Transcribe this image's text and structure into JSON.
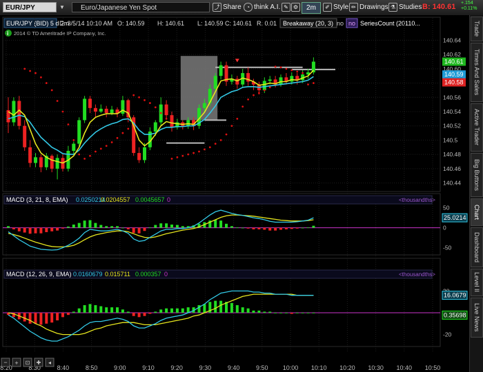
{
  "toolbar": {
    "symbol": "EUR/JPY",
    "description": "Euro/Japanese Yen Spot",
    "share": "Share",
    "think": "think A.I.",
    "aggregation": "2m",
    "style": "Style",
    "drawings": "Drawings",
    "studies": "Studies",
    "bid_price": "B: 140.61",
    "change": "+.154",
    "change_pct": "+0.11%"
  },
  "sidebar": {
    "tabs": [
      "Trade",
      "Times And Sales",
      "Active Trader",
      "Big Buttons",
      "Chart",
      "Dashboard",
      "Level II",
      "Live News"
    ]
  },
  "price_header": {
    "symbol": "EUR/JPY (BID) 5 d 2m",
    "date": "D: 3/5/14 10:10 AM",
    "open": "O: 140.59",
    "high": "H: 140.61",
    "low": "L: 140.59",
    "close": "C: 140.61",
    "range": "R: 0.01",
    "study": "Breakaway (20, 3)",
    "no1": "no",
    "no2": "no",
    "series": "SeriesCount (20110...",
    "copyright": "2014 © TD Ameritrade IP Company, Inc."
  },
  "colors": {
    "up": "#22dd22",
    "down": "#ee2222",
    "fast_ma": "#e6e61e",
    "slow_ma": "#33c9e6",
    "psar": "#dd1111",
    "zero_line": "#cc33cc"
  },
  "chart_data": [
    {
      "type": "candlestick",
      "title": "EUR/JPY (BID) 5 d 2m",
      "y_ticks": [
        "140.64",
        "140.62",
        "140.60",
        "140.58",
        "140.56",
        "140.54",
        "140.52",
        "140.5",
        "140.48",
        "140.46",
        "140.44"
      ],
      "y_tick_values": [
        140.64,
        140.62,
        140.6,
        140.58,
        140.56,
        140.54,
        140.52,
        140.5,
        140.48,
        140.46,
        140.44
      ],
      "ylim": [
        140.428,
        140.652
      ],
      "x_labels": [
        "8:20",
        "8:30",
        "8:40",
        "8:50",
        "9:00",
        "9:10",
        "9:20",
        "9:30",
        "9:40",
        "9:50",
        "10:00",
        "10:10",
        "10:20",
        "10:30",
        "10:40",
        "10:50"
      ],
      "price_labels": [
        {
          "text": "140.61",
          "value": 140.61,
          "color": "#1fb81f"
        },
        {
          "text": "140.59",
          "value": 140.592,
          "color": "#1e9bd6"
        },
        {
          "text": "140.58",
          "value": 140.581,
          "color": "#dd2222"
        }
      ],
      "candles": [
        {
          "o": 140.542,
          "c": 140.525,
          "h": 140.56,
          "l": 140.51
        },
        {
          "o": 140.525,
          "c": 140.555,
          "h": 140.56,
          "l": 140.52
        },
        {
          "o": 140.555,
          "c": 140.52,
          "h": 140.562,
          "l": 140.515
        },
        {
          "o": 140.52,
          "c": 140.49,
          "h": 140.528,
          "l": 140.485
        },
        {
          "o": 140.49,
          "c": 140.468,
          "h": 140.5,
          "l": 140.462
        },
        {
          "o": 140.468,
          "c": 140.476,
          "h": 140.482,
          "l": 140.462
        },
        {
          "o": 140.476,
          "c": 140.462,
          "h": 140.48,
          "l": 140.455
        },
        {
          "o": 140.462,
          "c": 140.478,
          "h": 140.482,
          "l": 140.458
        },
        {
          "o": 140.478,
          "c": 140.46,
          "h": 140.48,
          "l": 140.455
        },
        {
          "o": 140.46,
          "c": 140.475,
          "h": 140.48,
          "l": 140.445
        },
        {
          "o": 140.475,
          "c": 140.46,
          "h": 140.48,
          "l": 140.456
        },
        {
          "o": 140.46,
          "c": 140.485,
          "h": 140.492,
          "l": 140.456
        },
        {
          "o": 140.485,
          "c": 140.495,
          "h": 140.498,
          "l": 140.48
        },
        {
          "o": 140.495,
          "c": 140.528,
          "h": 140.532,
          "l": 140.49
        },
        {
          "o": 140.528,
          "c": 140.558,
          "h": 140.562,
          "l": 140.524
        },
        {
          "o": 140.558,
          "c": 140.545,
          "h": 140.562,
          "l": 140.538
        },
        {
          "o": 140.545,
          "c": 140.54,
          "h": 140.55,
          "l": 140.532
        },
        {
          "o": 140.54,
          "c": 140.544,
          "h": 140.55,
          "l": 140.538
        },
        {
          "o": 140.544,
          "c": 140.538,
          "h": 140.548,
          "l": 140.532
        },
        {
          "o": 140.538,
          "c": 140.543,
          "h": 140.548,
          "l": 140.535
        },
        {
          "o": 140.543,
          "c": 140.537,
          "h": 140.546,
          "l": 140.532
        },
        {
          "o": 140.537,
          "c": 140.556,
          "h": 140.562,
          "l": 140.534
        },
        {
          "o": 140.556,
          "c": 140.532,
          "h": 140.558,
          "l": 140.525
        },
        {
          "o": 140.532,
          "c": 140.482,
          "h": 140.535,
          "l": 140.478
        },
        {
          "o": 140.482,
          "c": 140.472,
          "h": 140.49,
          "l": 140.468
        },
        {
          "o": 140.472,
          "c": 140.49,
          "h": 140.496,
          "l": 140.468
        },
        {
          "o": 140.49,
          "c": 140.512,
          "h": 140.518,
          "l": 140.486
        },
        {
          "o": 140.512,
          "c": 140.525,
          "h": 140.528,
          "l": 140.506
        },
        {
          "o": 140.525,
          "c": 140.55,
          "h": 140.56,
          "l": 140.52
        },
        {
          "o": 140.55,
          "c": 140.535,
          "h": 140.556,
          "l": 140.53
        },
        {
          "o": 140.535,
          "c": 140.518,
          "h": 140.54,
          "l": 140.512
        },
        {
          "o": 140.518,
          "c": 140.525,
          "h": 140.53,
          "l": 140.515
        },
        {
          "o": 140.525,
          "c": 140.52,
          "h": 140.528,
          "l": 140.515
        },
        {
          "o": 140.52,
          "c": 140.528,
          "h": 140.532,
          "l": 140.516
        },
        {
          "o": 140.528,
          "c": 140.52,
          "h": 140.532,
          "l": 140.514
        },
        {
          "o": 140.52,
          "c": 140.545,
          "h": 140.55,
          "l": 140.516
        },
        {
          "o": 140.545,
          "c": 140.552,
          "h": 140.558,
          "l": 140.54
        },
        {
          "o": 140.552,
          "c": 140.572,
          "h": 140.578,
          "l": 140.548
        },
        {
          "o": 140.572,
          "c": 140.59,
          "h": 140.594,
          "l": 140.568
        },
        {
          "o": 140.59,
          "c": 140.605,
          "h": 140.61,
          "l": 140.585
        },
        {
          "o": 140.605,
          "c": 140.582,
          "h": 140.61,
          "l": 140.576
        },
        {
          "o": 140.582,
          "c": 140.586,
          "h": 140.592,
          "l": 140.578
        },
        {
          "o": 140.586,
          "c": 140.578,
          "h": 140.59,
          "l": 140.572
        },
        {
          "o": 140.578,
          "c": 140.594,
          "h": 140.6,
          "l": 140.575
        },
        {
          "o": 140.594,
          "c": 140.582,
          "h": 140.602,
          "l": 140.576
        },
        {
          "o": 140.582,
          "c": 140.578,
          "h": 140.586,
          "l": 140.57
        },
        {
          "o": 140.578,
          "c": 140.57,
          "h": 140.582,
          "l": 140.564
        },
        {
          "o": 140.57,
          "c": 140.583,
          "h": 140.588,
          "l": 140.566
        },
        {
          "o": 140.583,
          "c": 140.585,
          "h": 140.59,
          "l": 140.578
        },
        {
          "o": 140.585,
          "c": 140.578,
          "h": 140.59,
          "l": 140.574
        },
        {
          "o": 140.578,
          "c": 140.588,
          "h": 140.592,
          "l": 140.575
        },
        {
          "o": 140.588,
          "c": 140.582,
          "h": 140.594,
          "l": 140.578
        },
        {
          "o": 140.582,
          "c": 140.59,
          "h": 140.595,
          "l": 140.578
        },
        {
          "o": 140.59,
          "c": 140.584,
          "h": 140.594,
          "l": 140.578
        },
        {
          "o": 140.584,
          "c": 140.592,
          "h": 140.598,
          "l": 140.58
        },
        {
          "o": 140.592,
          "c": 140.595,
          "h": 140.6,
          "l": 140.586
        },
        {
          "o": 140.595,
          "c": 140.61,
          "h": 140.616,
          "l": 140.592
        }
      ],
      "fast_ma": [
        140.54,
        140.535,
        140.542,
        140.535,
        140.515,
        140.495,
        140.482,
        140.476,
        140.472,
        140.47,
        140.468,
        140.472,
        140.478,
        140.49,
        140.51,
        140.525,
        140.532,
        140.535,
        140.537,
        140.537,
        140.537,
        140.542,
        140.538,
        140.52,
        140.5,
        140.492,
        140.498,
        140.508,
        140.52,
        140.526,
        140.524,
        140.523,
        140.522,
        140.523,
        140.522,
        140.53,
        140.539,
        140.553,
        140.568,
        140.583,
        140.585,
        140.586,
        140.583,
        140.587,
        140.585,
        140.582,
        140.577,
        140.578,
        140.58,
        140.579,
        140.582,
        140.582,
        140.585,
        140.584,
        140.587,
        140.59,
        140.598
      ],
      "slow_ma": [
        140.53,
        140.532,
        140.535,
        140.533,
        140.525,
        140.514,
        140.504,
        140.497,
        140.49,
        140.486,
        140.481,
        140.48,
        140.48,
        140.486,
        140.496,
        140.504,
        140.511,
        140.516,
        140.52,
        140.523,
        140.525,
        140.529,
        140.53,
        140.524,
        140.514,
        140.508,
        140.508,
        140.51,
        140.515,
        140.518,
        140.518,
        140.519,
        140.519,
        140.52,
        140.52,
        140.524,
        140.529,
        140.538,
        140.548,
        140.56,
        140.564,
        140.568,
        140.57,
        140.574,
        140.575,
        140.575,
        140.574,
        140.575,
        140.576,
        140.577,
        140.578,
        140.579,
        140.58,
        140.581,
        140.582,
        140.584,
        140.589
      ],
      "psar": [
        [
          3,
          140.6
        ],
        [
          4,
          140.597
        ],
        [
          5,
          140.594
        ],
        [
          6,
          140.588
        ],
        [
          7,
          140.58
        ],
        [
          8,
          140.57
        ],
        [
          9,
          140.555
        ],
        [
          10,
          140.54
        ],
        [
          11,
          140.522
        ],
        [
          12,
          140.5
        ],
        [
          13,
          140.48
        ],
        [
          14,
          140.474
        ],
        [
          15,
          140.478
        ],
        [
          16,
          140.484
        ],
        [
          17,
          140.488
        ],
        [
          18,
          140.492
        ],
        [
          19,
          140.497
        ],
        [
          20,
          140.503
        ],
        [
          21,
          140.51
        ],
        [
          22,
          140.516
        ],
        [
          23,
          140.563
        ],
        [
          24,
          140.56
        ],
        [
          25,
          140.556
        ],
        [
          26,
          140.552
        ],
        [
          27,
          140.546
        ],
        [
          28,
          140.538
        ],
        [
          29,
          140.53
        ],
        [
          30,
          140.474
        ],
        [
          31,
          140.476
        ],
        [
          32,
          140.478
        ],
        [
          33,
          140.48
        ],
        [
          34,
          140.482
        ],
        [
          35,
          140.484
        ],
        [
          36,
          140.487
        ],
        [
          37,
          140.49
        ],
        [
          38,
          140.495
        ],
        [
          39,
          140.5
        ],
        [
          40,
          140.508
        ],
        [
          41,
          140.52
        ],
        [
          42,
          140.53
        ],
        [
          43,
          140.547
        ],
        [
          44,
          140.557
        ],
        [
          45,
          140.563
        ],
        [
          46,
          140.566
        ],
        [
          47,
          140.57
        ],
        [
          48,
          140.574
        ],
        [
          49,
          140.603
        ],
        [
          50,
          140.602
        ],
        [
          51,
          140.6
        ],
        [
          52,
          140.598
        ],
        [
          53,
          140.596
        ],
        [
          54,
          140.594
        ],
        [
          55,
          140.578
        ],
        [
          56,
          140.58
        ]
      ],
      "breakaway_box": {
        "i0": 32,
        "i1": 38,
        "low": 140.528,
        "high": 140.618
      },
      "lines": [
        {
          "i0": 29,
          "i1": 36,
          "v": 140.496
        },
        {
          "i0": 36,
          "i1": 40,
          "v": 140.528
        },
        {
          "i0": 38,
          "i1": 54,
          "v": 140.602
        },
        {
          "i0": 52,
          "i1": 60,
          "v": 140.599
        }
      ],
      "arrow_index": 42
    },
    {
      "type": "bar",
      "title": "MACD (3, 21, 8, EMA)",
      "values_text": [
        "0.0250214",
        "0.0204557",
        "0.0045657",
        "0"
      ],
      "units_label": "<thousandths>",
      "y_ticks": [
        "50",
        "0",
        "-50"
      ],
      "y_tick_values": [
        50,
        0,
        -50
      ],
      "ylim": [
        -68,
        58
      ],
      "value_label": "25.0214",
      "value_label_value": 25.02,
      "macd": [
        -10,
        -20,
        -30,
        -38,
        -46,
        -50,
        -54,
        -55,
        -56,
        -55,
        -50,
        -44,
        -36,
        -26,
        -12,
        -4,
        -6,
        -8,
        -8,
        -6,
        -4,
        -8,
        -14,
        -28,
        -34,
        -32,
        -24,
        -16,
        -8,
        -4,
        -4,
        -2,
        -2,
        0,
        4,
        12,
        22,
        32,
        40,
        44,
        40,
        36,
        33,
        31,
        28,
        25,
        23,
        20,
        16,
        14,
        14,
        14,
        14,
        15,
        17,
        19,
        25
      ],
      "signal": [
        -14,
        -17,
        -21,
        -26,
        -31,
        -36,
        -40,
        -44,
        -47,
        -48,
        -48,
        -47,
        -44,
        -38,
        -30,
        -23,
        -18,
        -15,
        -12,
        -10,
        -8,
        -8,
        -10,
        -15,
        -20,
        -24,
        -25,
        -23,
        -19,
        -15,
        -12,
        -9,
        -6,
        -4,
        -2,
        2,
        8,
        14,
        20,
        26,
        30,
        32,
        32,
        31,
        30,
        29,
        27,
        25,
        23,
        21,
        19,
        18,
        17,
        17,
        17,
        18,
        20
      ],
      "hist": [
        4,
        -4,
        -9,
        -12,
        -15,
        -14,
        -14,
        -11,
        -9,
        -7,
        -2,
        3,
        8,
        12,
        18,
        19,
        12,
        7,
        4,
        4,
        4,
        0,
        -4,
        -13,
        -14,
        -8,
        1,
        7,
        11,
        11,
        8,
        7,
        4,
        4,
        6,
        10,
        14,
        18,
        20,
        18,
        10,
        4,
        1,
        0,
        -2,
        -4,
        -4,
        -5,
        -7,
        -7,
        -5,
        -4,
        -3,
        -2,
        0,
        1,
        5
      ]
    },
    {
      "type": "bar",
      "title": "MACD (12, 26, 9, EMA)",
      "values_text": [
        "0.0160679",
        "0.015711",
        "0.000357",
        "0"
      ],
      "units_label": "<thousandths>",
      "y_ticks": [
        "20",
        "0",
        "-20"
      ],
      "y_tick_values": [
        20,
        0,
        -20
      ],
      "ylim": [
        -31,
        31
      ],
      "value_label_macd": "16.0679",
      "value_label_macd_value": 16.07,
      "value_label_hist": "0.35698",
      "value_label_hist_value": 0.36,
      "macd": [
        -2,
        -5,
        -9,
        -13,
        -17,
        -20,
        -23,
        -25,
        -26,
        -26,
        -24,
        -22,
        -19,
        -16,
        -12,
        -9,
        -8,
        -8,
        -7,
        -6,
        -5,
        -6,
        -8,
        -12,
        -14,
        -14,
        -12,
        -10,
        -7,
        -5,
        -4,
        -3,
        -2,
        0,
        2,
        5,
        8,
        12,
        15,
        18,
        19,
        20,
        20,
        20,
        20,
        19,
        19,
        18,
        18,
        17,
        17,
        17,
        16,
        16,
        16,
        16,
        16
      ],
      "signal": [
        0,
        -1,
        -3,
        -5,
        -7,
        -10,
        -12,
        -15,
        -17,
        -19,
        -20,
        -20,
        -20,
        -20,
        -19,
        -17,
        -15,
        -14,
        -12,
        -11,
        -10,
        -9,
        -9,
        -9,
        -10,
        -11,
        -11,
        -11,
        -10,
        -9,
        -8,
        -7,
        -6,
        -5,
        -3,
        -2,
        0,
        2,
        4,
        7,
        9,
        11,
        13,
        15,
        16,
        17,
        17,
        17,
        17,
        17,
        17,
        17,
        17,
        16,
        16,
        16,
        16
      ],
      "hist": [
        -2,
        -4,
        -6,
        -8,
        -10,
        -10,
        -11,
        -10,
        -9,
        -7,
        -4,
        -2,
        1,
        4,
        7,
        8,
        7,
        6,
        5,
        5,
        5,
        3,
        1,
        -3,
        -4,
        -3,
        -1,
        1,
        3,
        4,
        4,
        4,
        4,
        5,
        5,
        7,
        8,
        10,
        11,
        11,
        10,
        9,
        7,
        5,
        4,
        2,
        2,
        1,
        1,
        0,
        0,
        0,
        -1,
        0,
        0,
        0,
        0
      ]
    }
  ]
}
